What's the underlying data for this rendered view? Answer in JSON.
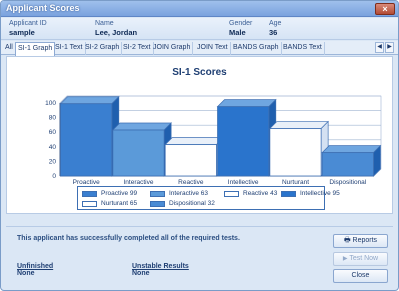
{
  "window": {
    "title": "Applicant Scores",
    "close_label": "×"
  },
  "applicant": {
    "id_label": "Applicant ID",
    "id_value": "sample",
    "name_label": "Name",
    "name_value": "Lee, Jordan",
    "gender_label": "Gender",
    "gender_value": "Male",
    "age_label": "Age",
    "age_value": "36"
  },
  "tabs": [
    "All",
    "SI-1 Graph",
    "SI-1 Text",
    "SI-2 Graph",
    "SI-2 Text",
    "JOIN Graph",
    "JOIN Text",
    "BANDS Graph",
    "BANDS Text"
  ],
  "active_tab": "SI-1 Graph",
  "tab_scroll": {
    "left": "◀",
    "right": "▶"
  },
  "chart_data": {
    "type": "bar",
    "title": "SI-1 Scores",
    "categories": [
      "Proactive",
      "Interactive",
      "Reactive",
      "Intellective",
      "Nurturant",
      "Dispositional"
    ],
    "values": [
      99,
      63,
      43,
      95,
      65,
      32
    ],
    "ylim": [
      0,
      100
    ],
    "yticks": [
      0,
      20,
      40,
      60,
      80,
      100
    ],
    "colors": [
      "#3a7fd0",
      "#5b9ad9",
      "#ffffff",
      "#2a74cc",
      "#ffffff",
      "#4a8bd4"
    ],
    "legend": [
      {
        "label": "Proactive",
        "value": "99"
      },
      {
        "label": "Interactive",
        "value": "63"
      },
      {
        "label": "Reactive",
        "value": "43"
      },
      {
        "label": "Intellective",
        "value": "95"
      },
      {
        "label": "Nurturant",
        "value": "65"
      },
      {
        "label": "Dispositional",
        "value": "32"
      }
    ]
  },
  "message": "This applicant has successfully completed all of the required tests.",
  "status": {
    "unfinished_label": "Unfinished",
    "unfinished_value": "None",
    "unstable_label": "Unstable Results",
    "unstable_value": "None"
  },
  "buttons": {
    "reports": "Reports",
    "test_now": "Test Now",
    "close": "Close"
  }
}
